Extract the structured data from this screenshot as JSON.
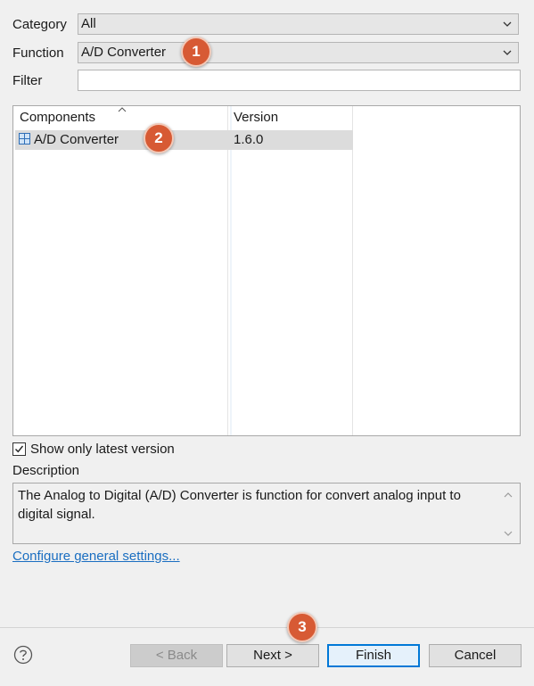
{
  "form": {
    "category_label": "Category",
    "category_value": "All",
    "function_label": "Function",
    "function_value": "A/D Converter",
    "filter_label": "Filter",
    "filter_value": ""
  },
  "table": {
    "columns": [
      "Components",
      "Version"
    ],
    "rows": [
      {
        "component": "A/D Converter",
        "version": "1.6.0",
        "icon": "component-grid-icon"
      }
    ]
  },
  "options": {
    "show_latest_label": "Show only latest version",
    "show_latest_checked": true
  },
  "description": {
    "label": "Description",
    "text": "The Analog to Digital (A/D) Converter is function for convert analog input to digital signal."
  },
  "link": {
    "configure_label": "Configure general settings..."
  },
  "buttons": {
    "back": "< Back",
    "next": "Next >",
    "finish": "Finish",
    "cancel": "Cancel"
  },
  "callouts": [
    "1",
    "2",
    "3"
  ],
  "icons": {
    "help": "help-icon",
    "sort": "sort-asc-icon"
  },
  "colors": {
    "callout": "#d75a34",
    "link": "#1a6ec1",
    "default_button_border": "#0078d7"
  }
}
